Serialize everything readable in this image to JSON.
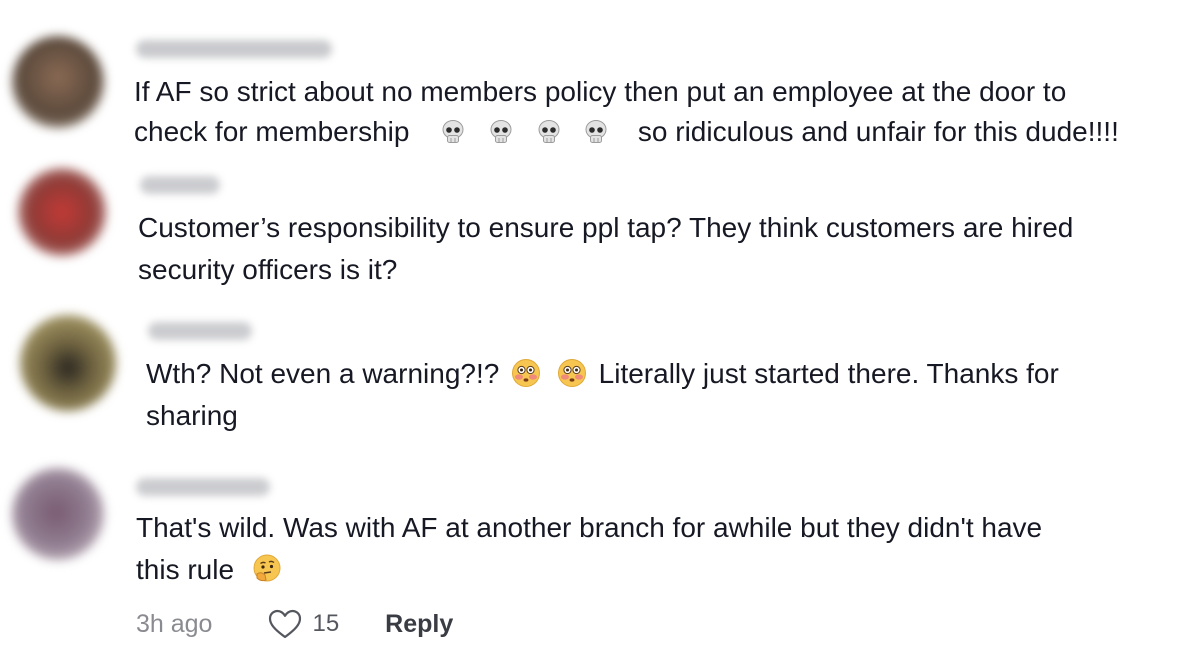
{
  "comments": [
    {
      "username": "",
      "text_lines": [
        "If AF so strict about no members policy then put an employee at the door to",
        "check for membership",
        "so ridiculous and unfair for this dude!!!!"
      ],
      "avatar_color": "#6f5a48"
    },
    {
      "username": "",
      "text_lines": [
        "Customer’s responsibility to ensure ppl tap? They think customers are hired",
        "security officers is it?"
      ],
      "avatar_color": "#a8423d"
    },
    {
      "username": "",
      "text_lines": [
        "Wth? Not even a warning?!?",
        "Literally just started there. Thanks for",
        "sharing"
      ],
      "avatar_color": "#7c6f45"
    },
    {
      "username": "",
      "text_lines": [
        "That's wild. Was with AF at another branch for awhile but they didn't have",
        "this rule"
      ],
      "avatar_color": "#7a6278",
      "meta": {
        "timestamp": "3h ago",
        "like_count": "15",
        "reply_label": "Reply"
      }
    }
  ],
  "icons": {
    "skull": "skull-emoji",
    "flushed": "flushed-face-emoji",
    "thinking": "thinking-face-emoji",
    "like": "heart-outline-icon"
  }
}
